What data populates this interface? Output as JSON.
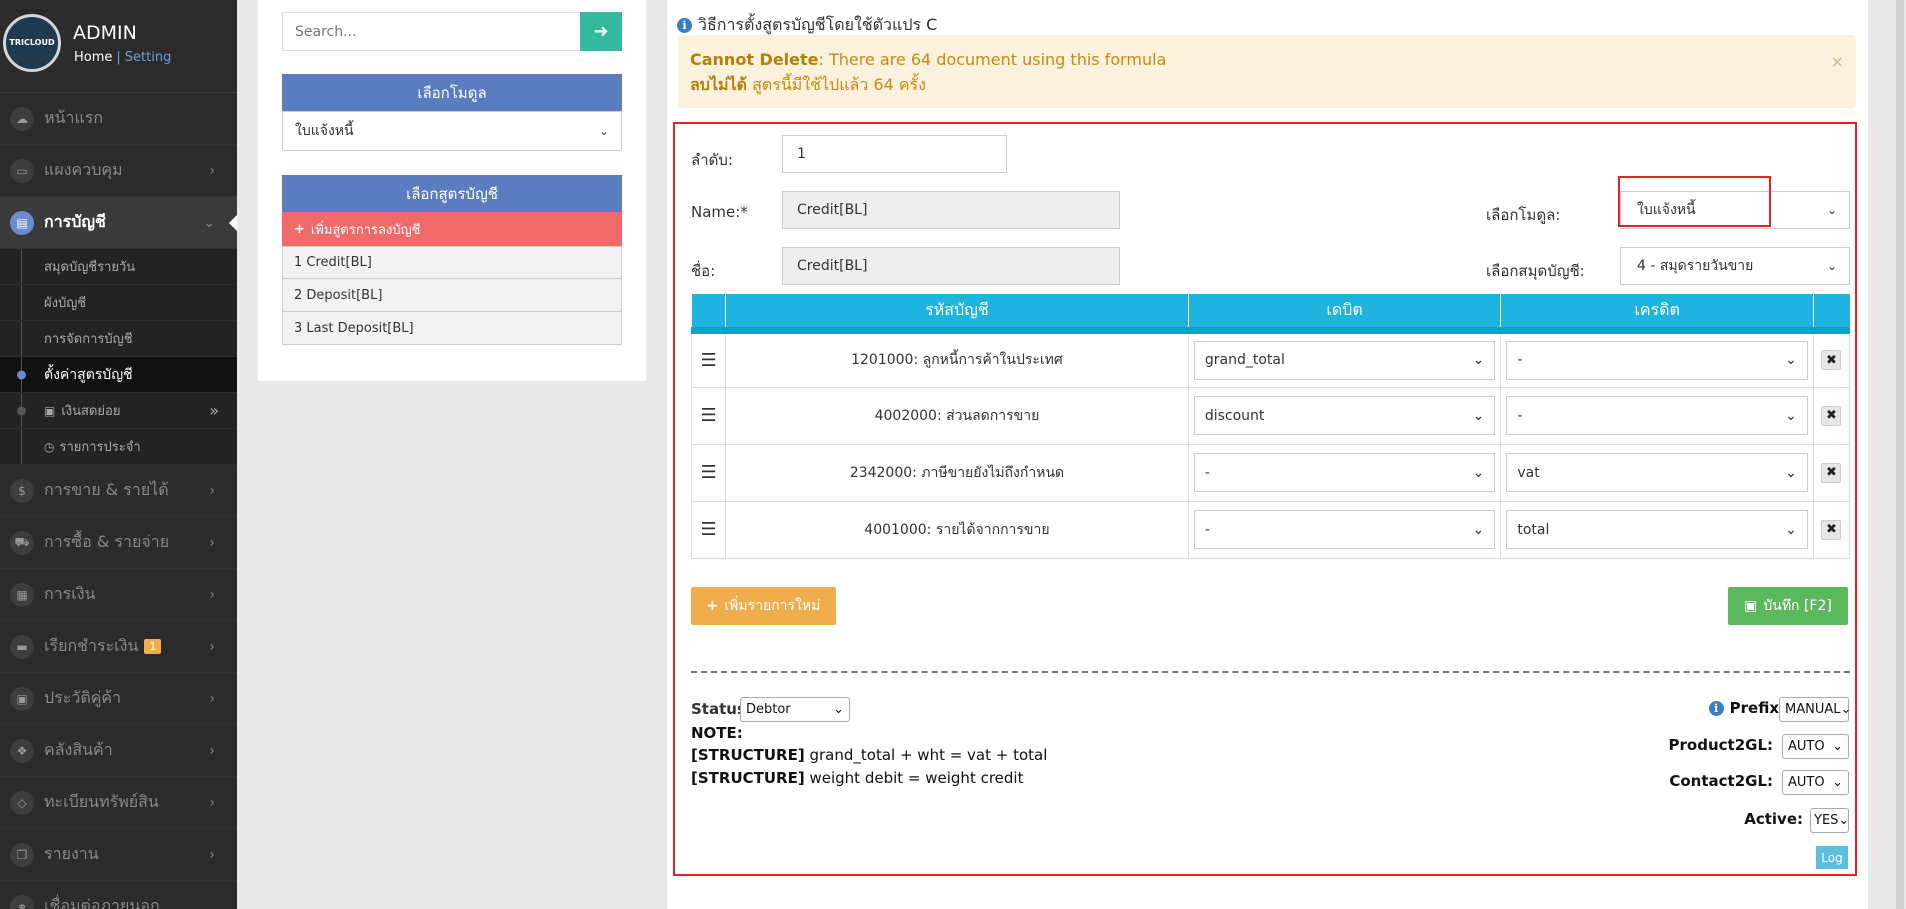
{
  "profile": {
    "avatar_text": "TRICLOUD",
    "name": "ADMIN",
    "home": "Home",
    "separator": "|",
    "setting": "Setting"
  },
  "nav": {
    "home": "หน้าแรก",
    "dashboard": "แผงควบคุม",
    "accounting": "การบัญชี",
    "sales": "การขาย & รายได้",
    "purchase": "การซื้อ & รายจ่าย",
    "finance": "การเงิน",
    "billing": "เรียกชำระเงิน",
    "billing_badge": "1",
    "contacts": "ประวัติคู่ค้า",
    "inventory": "คลังสินค้า",
    "assets": "ทะเบียนทรัพย์สิน",
    "reports": "รายงาน",
    "last_partial": "เชื่อมต่อภายนอก"
  },
  "subnav": {
    "daily_journal": "สมุดบัญชีรายวัน",
    "chart_of_accounts": "ผังบัญชี",
    "account_management": "การจัดการบัญชี",
    "account_formula": "ตั้งค่าสูตรบัญชี",
    "petty_cash": "เงินสดย่อย",
    "recurring": "รายการประจำ"
  },
  "left_panel": {
    "search_placeholder": "Search...",
    "module_header": "เลือกโมดูล",
    "module_value": "ใบแจ้งหนี้",
    "formula_header": "เลือกสูตรบัญชี",
    "add_formula": "เพิ่มสูตรการลงบัญชี",
    "formulas": [
      "1 Credit[BL]",
      "2 Deposit[BL]",
      "3 Last Deposit[BL]"
    ]
  },
  "main": {
    "info_title": "วิธีการตั้งสูตรบัญชีโดยใช้ตัวแปร C",
    "alert_line1_bold": "Cannot Delete",
    "alert_line1": ": There are 64 document using this formula",
    "alert_line2_bold": "ลบไม่ได้",
    "alert_line2": "สูตรนี้มีใช้ไปแล้ว 64 ครั้ง",
    "alert_close": "×",
    "form": {
      "order_label": "ลำดับ:",
      "order_value": "1",
      "name_label": "Name:*",
      "name_value": "Credit[BL]",
      "thai_name_label": "ชื่อ:",
      "thai_name_value": "Credit[BL]",
      "module_label": "เลือกโมดูล:",
      "module_value": "ใบแจ้งหนี้",
      "journal_label": "เลือกสมุดบัญชี:",
      "journal_value": "4 - สมุดรายวันขาย"
    },
    "table": {
      "headers": [
        "รหัสบัญชี",
        "เดบิต",
        "เครดิต"
      ],
      "rows": [
        {
          "account": "1201000: ลูกหนี้การค้าในประเทศ",
          "debit": "grand_total",
          "credit": "-"
        },
        {
          "account": "4002000: ส่วนลดการขาย",
          "debit": "discount",
          "credit": "-"
        },
        {
          "account": "2342000: ภาษีขายยังไม่ถึงกำหนด",
          "debit": "-",
          "credit": "vat"
        },
        {
          "account": "4001000: รายได้จากการขาย",
          "debit": "-",
          "credit": "total"
        }
      ]
    },
    "add_row_button": "เพิ่มรายการใหม่",
    "save_button": "บันทึก [F2]",
    "status_label": "Status:",
    "status_value": "Debtor",
    "note_label": "NOTE:",
    "note1_tag": "[STRUCTURE]",
    "note1_text": "grand_total + wht = vat + total",
    "note2_tag": "[STRUCTURE]",
    "note2_text": "weight debit = weight credit",
    "prefix_label": "Prefix:",
    "prefix_value": "MANUAL",
    "product2gl_label": "Product2GL:",
    "product2gl_value": "AUTO",
    "contact2gl_label": "Contact2GL:",
    "contact2gl_value": "AUTO",
    "active_label": "Active:",
    "active_value": "YES",
    "log_button": "Log"
  }
}
